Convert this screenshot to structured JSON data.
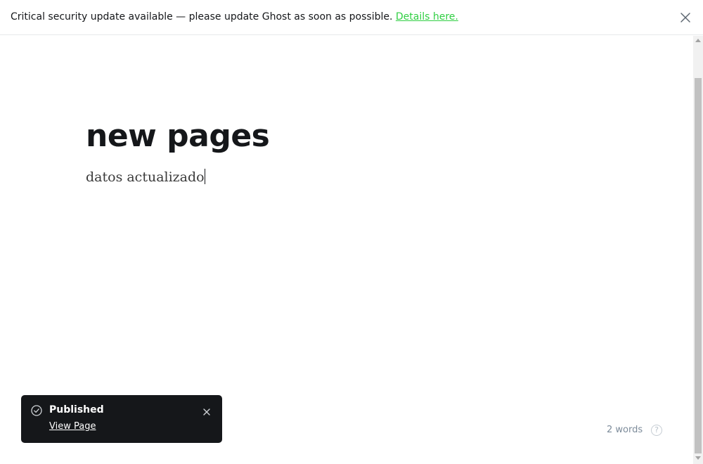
{
  "banner": {
    "message": "Critical security update available — please update Ghost as soon as possible. ",
    "link_text": "Details here.",
    "close_icon": "close-icon"
  },
  "editor": {
    "title": "new pages",
    "body": "datos actualizado",
    "word_count": "2 words",
    "help_label": "?"
  },
  "toast": {
    "title": "Published",
    "link_text": "View Page",
    "status_icon": "check-circle-icon",
    "close_icon": "close-icon"
  },
  "colors": {
    "accent_link": "#30cf43",
    "toast_bg": "#15171a",
    "text": "#15171a",
    "muted": "#7c8b9a"
  }
}
